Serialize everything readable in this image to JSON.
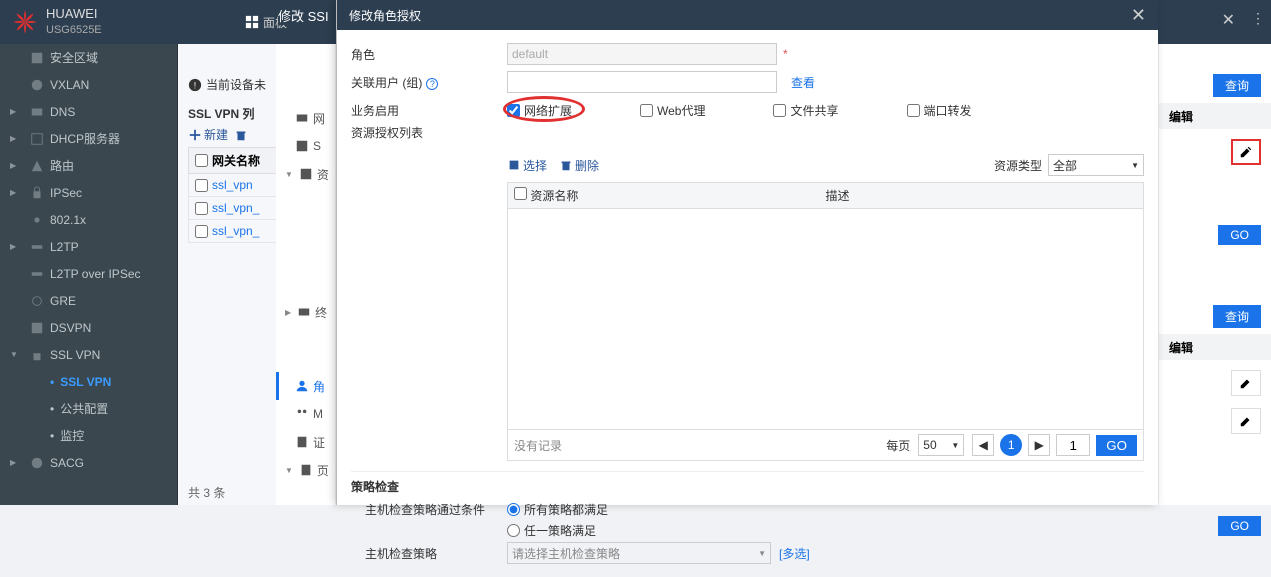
{
  "header": {
    "brand": "HUAWEI",
    "model": "USG6525E",
    "dashboard_label": "面板"
  },
  "nav": {
    "items": [
      {
        "label": "安全区域"
      },
      {
        "label": "VXLAN"
      },
      {
        "label": "DNS"
      },
      {
        "label": "DHCP服务器"
      },
      {
        "label": "路由"
      },
      {
        "label": "IPSec"
      },
      {
        "label": "802.1x"
      },
      {
        "label": "L2TP"
      },
      {
        "label": "L2TP over IPSec"
      },
      {
        "label": "GRE"
      },
      {
        "label": "DSVPN"
      }
    ],
    "sslvpn_label": "SSL VPN",
    "sslvpn_sub1": "SSL VPN",
    "sslvpn_sub2": "公共配置",
    "sslvpn_sub3": "监控",
    "sacg_label": "SACG"
  },
  "mid": {
    "tip": "当前设备未",
    "list_title": "SSL VPN 列",
    "btn_new": "新建",
    "gw_header": "网关名称",
    "rows": [
      "ssl_vpn",
      "ssl_vpn_",
      "ssl_vpn_"
    ],
    "total": "共 3 条"
  },
  "sec": {
    "items": [
      "网",
      "S",
      "资",
      "终",
      "角",
      "M",
      "证",
      "页"
    ]
  },
  "behind_modal": "修改 SSI",
  "modal": {
    "title": "修改角色授权",
    "role_label": "角色",
    "role_value": "default",
    "user_label": "关联用户 (组)",
    "view_link": "查看",
    "service_enable": "业务启用",
    "svc_net": "网络扩展",
    "svc_web": "Web代理",
    "svc_file": "文件共享",
    "svc_port": "端口转发",
    "res_list_label": "资源授权列表",
    "select_label": "选择",
    "del_label": "删除",
    "res_type_label": "资源类型",
    "res_type_value": "全部",
    "col_name": "资源名称",
    "col_desc": "描述",
    "no_record": "没有记录",
    "per_page": "每页",
    "per_page_value": "50",
    "page_value": "1",
    "go": "GO",
    "policy_title": "策略检查",
    "host_cond_label": "主机检查策略通过条件",
    "cond_all": "所有策略都满足",
    "cond_any": "任一策略满足",
    "host_policy_label": "主机检查策略",
    "host_policy_placeholder": "请选择主机检查策略",
    "multi": "[多选]"
  },
  "right": {
    "query": "查询",
    "edit": "编辑",
    "go": "GO"
  }
}
